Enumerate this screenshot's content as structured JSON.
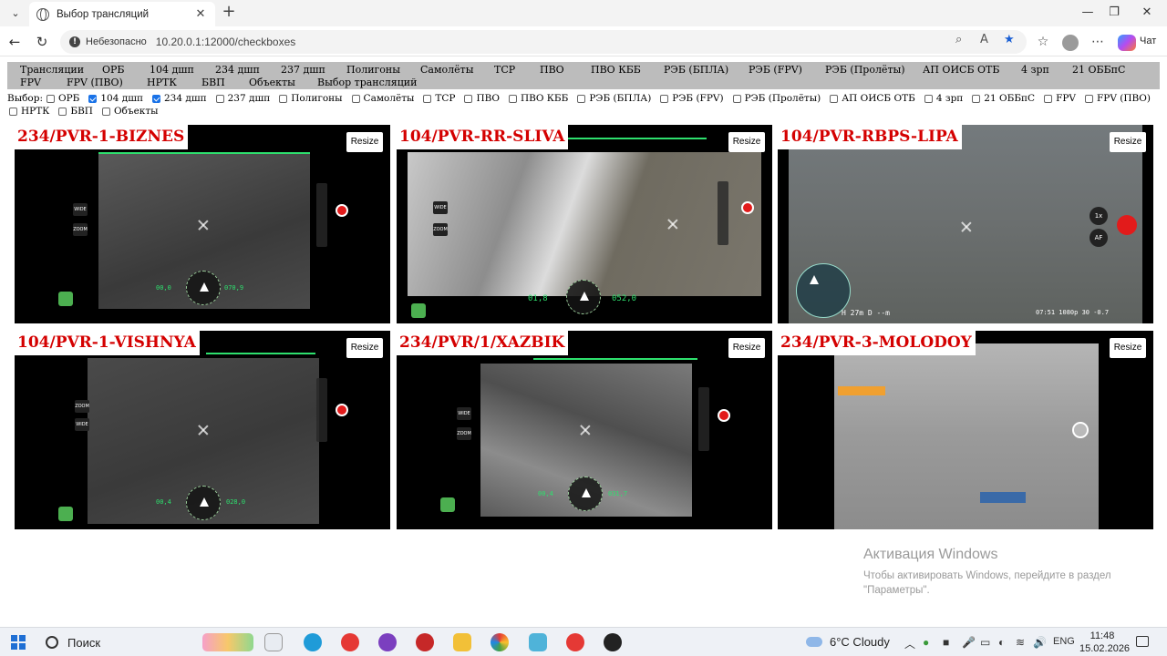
{
  "browser": {
    "tab_title": "Выбор трансляций",
    "insecure_label": "Небезопасно",
    "url": "10.20.0.1:12000/checkboxes",
    "chat_label": "Чат"
  },
  "menu": [
    "Трансляции",
    "ОРБ",
    "104 дшп",
    "234 дшп",
    "237 дшп",
    "Полигоны",
    "Самолёты",
    "ТСР",
    "ПВО",
    "ПВО КББ",
    "РЭБ (БПЛА)",
    "РЭБ (FPV)",
    "РЭБ (Пролёты)",
    "АП ОИСБ ОТБ",
    "4 зрп",
    "21 ОББпС",
    "FPV",
    "FPV (ПВО)",
    "НРТК",
    "БВП",
    "Объекты",
    "Выбор трансляций"
  ],
  "filter": {
    "label": "Выбор:",
    "options": [
      {
        "label": "ОРБ",
        "checked": false
      },
      {
        "label": "104 дшп",
        "checked": true
      },
      {
        "label": "234 дшп",
        "checked": true
      },
      {
        "label": "237 дшп",
        "checked": false
      },
      {
        "label": "Полигоны",
        "checked": false
      },
      {
        "label": "Самолёты",
        "checked": false
      },
      {
        "label": "ТСР",
        "checked": false
      },
      {
        "label": "ПВО",
        "checked": false
      },
      {
        "label": "ПВО КББ",
        "checked": false
      },
      {
        "label": "РЭБ (БПЛА)",
        "checked": false
      },
      {
        "label": "РЭБ (FPV)",
        "checked": false
      },
      {
        "label": "РЭБ (Пролёты)",
        "checked": false
      },
      {
        "label": "АП ОИСБ ОТБ",
        "checked": false
      },
      {
        "label": "4 зрп",
        "checked": false
      },
      {
        "label": "21 ОББпС",
        "checked": false
      },
      {
        "label": "FPV",
        "checked": false
      },
      {
        "label": "FPV (ПВО)",
        "checked": false
      },
      {
        "label": "НРТК",
        "checked": false
      },
      {
        "label": "БВП",
        "checked": false
      },
      {
        "label": "Объекты",
        "checked": false
      }
    ]
  },
  "streams": [
    {
      "name": "234/PVR-1-BIZNES",
      "resize_label": "Resize"
    },
    {
      "name": "104/PVR-RR-SLIVA",
      "resize_label": "Resize"
    },
    {
      "name": "104/PVR-RBPS-LIPA",
      "resize_label": "Resize"
    },
    {
      "name": "104/PVR-1-VISHNYA",
      "resize_label": "Resize"
    },
    {
      "name": "234/PVR/1/XAZBIK",
      "resize_label": "Resize"
    },
    {
      "name": "234/PVR-3-MOLODOY",
      "resize_label": "Resize"
    }
  ],
  "activation": {
    "title": "Активация Windows",
    "line1": "Чтобы активировать Windows, перейдите в раздел",
    "line2": "\"Параметры\"."
  },
  "taskbar": {
    "search_label": "Поиск",
    "weather": "6°C  Cloudy",
    "lang": "ENG",
    "time": "11:48",
    "date": "15.02.2026"
  }
}
